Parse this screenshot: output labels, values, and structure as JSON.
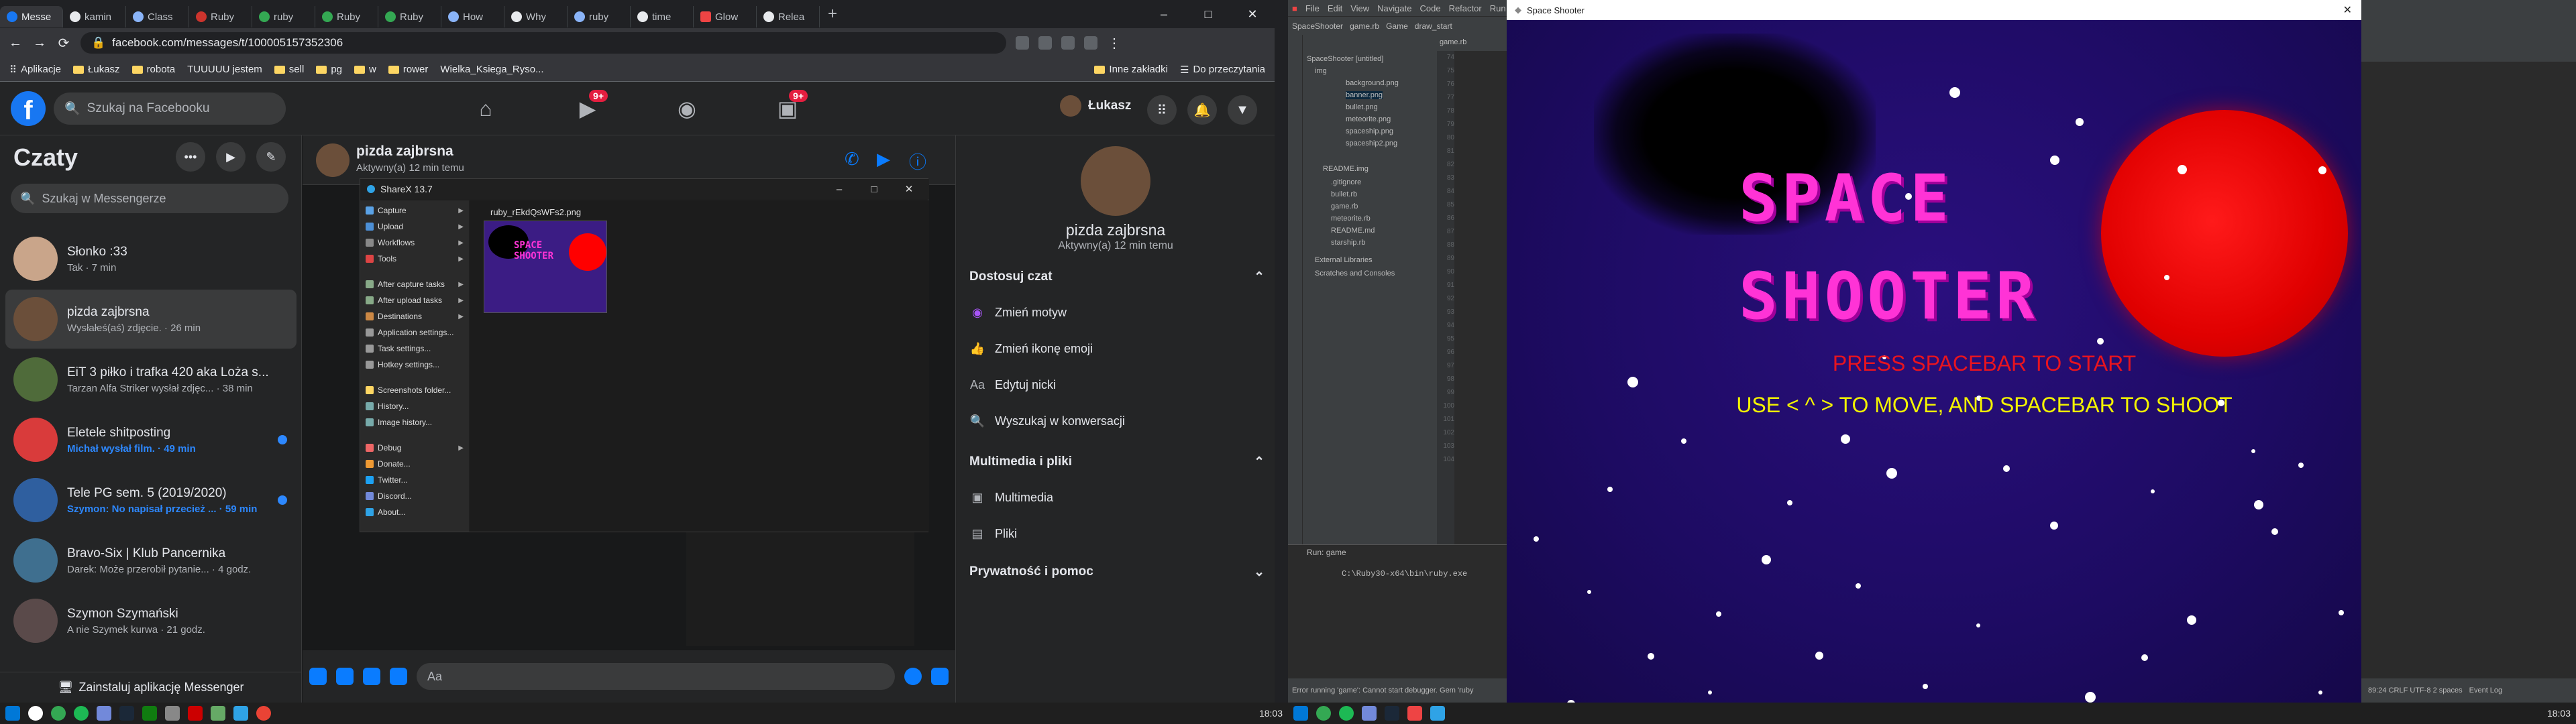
{
  "browser": {
    "tabs": [
      "Messe",
      "kamin",
      "Class",
      "Ruby",
      "ruby",
      "Ruby",
      "Ruby",
      "How",
      "Why",
      "ruby",
      "time",
      "Glow",
      "Relea"
    ],
    "url": "facebook.com/messages/t/100005157352306",
    "bookmarks": [
      "Aplikacje",
      "Łukasz",
      "robota",
      "TUUUUU jestem",
      "sell",
      "pg",
      "w",
      "rower",
      "Wielka_Ksiega_Ryso...",
      "Inne zakładki",
      "Do przeczytania"
    ]
  },
  "facebook": {
    "search_placeholder": "Szukaj na Facebooku",
    "profile_name": "Łukasz",
    "watch_badge": "9+",
    "groups_badge": "9+",
    "chats_title": "Czaty",
    "messenger_search_placeholder": "Szukaj w Messengerze",
    "conversations": [
      {
        "name": "Słonko :33",
        "preview": "Tak · 7 min",
        "unread": false
      },
      {
        "name": "pizda zajbrsna",
        "preview": "Wysłałeś(aś) zdjęcie. · 26 min",
        "unread": false
      },
      {
        "name": "EiT 3 piłko i trafka 420 aka Loża s...",
        "preview": "Tarzan Alfa Striker wysłał zdjęc... · 38 min",
        "unread": false
      },
      {
        "name": "Eletele shitposting",
        "preview": "Michał wysłał film. · 49 min",
        "unread": true
      },
      {
        "name": "Tele PG sem. 5 (2019/2020)",
        "preview": "Szymon: No napisał przecież ... · 59 min",
        "unread": true
      },
      {
        "name": "Bravo-Six | Klub Pancernika",
        "preview": "Darek: Może przerobił pytanie... · 4 godz.",
        "unread": false
      },
      {
        "name": "Szymon Szymański",
        "preview": "A nie Szymek kurwa · 21 godz.",
        "unread": false
      }
    ],
    "install_label": "Zainstaluj aplikację Messenger",
    "chat_name": "pizda zajbrsna",
    "chat_status": "Aktywny(a) 12 min temu",
    "composer_placeholder": "Aa",
    "info": {
      "name": "pizda zajbrsna",
      "status": "Aktywny(a) 12 min temu",
      "section_customize": "Dostosuj czat",
      "customize_items": [
        "Zmień motyw",
        "Zmień ikonę emoji",
        "Edytuj nicki",
        "Wyszukaj w konwersacji"
      ],
      "section_media": "Multimedia i pliki",
      "media_items": [
        "Multimedia",
        "Pliki"
      ],
      "section_privacy": "Prywatność i pomoc"
    }
  },
  "sharex": {
    "title": "ShareX 13.7",
    "menu": [
      "Capture",
      "Upload",
      "Workflows",
      "Tools",
      "After capture tasks",
      "After upload tasks",
      "Destinations",
      "Application settings...",
      "Task settings...",
      "Hotkey settings...",
      "Screenshots folder...",
      "History...",
      "Image history...",
      "Debug",
      "Donate...",
      "Twitter...",
      "Discord...",
      "About..."
    ],
    "filename": "ruby_rEkdQsWFs2.png"
  },
  "taskbar_left": {
    "time": "18:03"
  },
  "taskbar_right": {
    "time": "18:03"
  },
  "ide": {
    "menu": [
      "File",
      "Edit",
      "View",
      "Navigate",
      "Code",
      "Refactor",
      "Run"
    ],
    "crumbs": [
      "SpaceShooter",
      "game.rb",
      "Game",
      "draw_start"
    ],
    "tree": [
      "SpaceShooter [untitled]",
      "img",
      "background.png",
      "banner.png",
      "bullet.png",
      "meteorite.png",
      "spaceship.png",
      "spaceship2.png",
      "README.img",
      ".gitignore",
      "bullet.rb",
      "game.rb",
      "meteorite.rb",
      "README.md",
      "starship.rb",
      "External Libraries",
      "Scratches and Consoles"
    ],
    "run_tab": "game",
    "run_cmd": "C:\\Ruby30-x64\\bin\\ruby.exe",
    "status": "Error running 'game': Cannot start debugger. Gem 'ruby"
  },
  "game": {
    "window_title": "Space Shooter",
    "title_line1": "SPACE",
    "title_line2": "SHOOTER",
    "press": "PRESS SPACEBAR TO START",
    "instructions": "USE < ^ > TO MOVE, AND SPACEBAR TO SHOOT"
  },
  "ide_right": {
    "status": "89:24  CRLF  UTF-8  2 spaces",
    "event_log": "Event Log"
  }
}
